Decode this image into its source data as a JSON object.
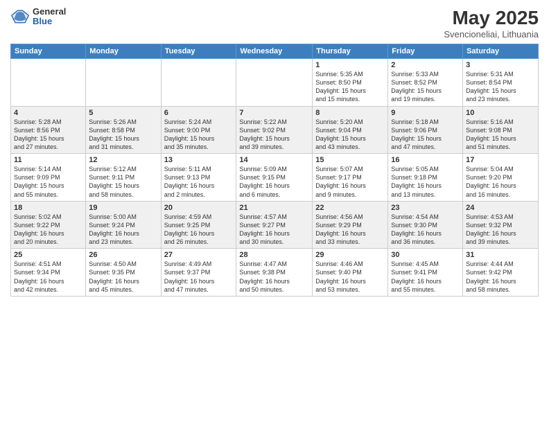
{
  "header": {
    "logo_general": "General",
    "logo_blue": "Blue",
    "title": "May 2025",
    "location": "Svencioneliai, Lithuania"
  },
  "days_of_week": [
    "Sunday",
    "Monday",
    "Tuesday",
    "Wednesday",
    "Thursday",
    "Friday",
    "Saturday"
  ],
  "weeks": [
    [
      {
        "day": "",
        "info": ""
      },
      {
        "day": "",
        "info": ""
      },
      {
        "day": "",
        "info": ""
      },
      {
        "day": "",
        "info": ""
      },
      {
        "day": "1",
        "info": "Sunrise: 5:35 AM\nSunset: 8:50 PM\nDaylight: 15 hours\nand 15 minutes."
      },
      {
        "day": "2",
        "info": "Sunrise: 5:33 AM\nSunset: 8:52 PM\nDaylight: 15 hours\nand 19 minutes."
      },
      {
        "day": "3",
        "info": "Sunrise: 5:31 AM\nSunset: 8:54 PM\nDaylight: 15 hours\nand 23 minutes."
      }
    ],
    [
      {
        "day": "4",
        "info": "Sunrise: 5:28 AM\nSunset: 8:56 PM\nDaylight: 15 hours\nand 27 minutes."
      },
      {
        "day": "5",
        "info": "Sunrise: 5:26 AM\nSunset: 8:58 PM\nDaylight: 15 hours\nand 31 minutes."
      },
      {
        "day": "6",
        "info": "Sunrise: 5:24 AM\nSunset: 9:00 PM\nDaylight: 15 hours\nand 35 minutes."
      },
      {
        "day": "7",
        "info": "Sunrise: 5:22 AM\nSunset: 9:02 PM\nDaylight: 15 hours\nand 39 minutes."
      },
      {
        "day": "8",
        "info": "Sunrise: 5:20 AM\nSunset: 9:04 PM\nDaylight: 15 hours\nand 43 minutes."
      },
      {
        "day": "9",
        "info": "Sunrise: 5:18 AM\nSunset: 9:06 PM\nDaylight: 15 hours\nand 47 minutes."
      },
      {
        "day": "10",
        "info": "Sunrise: 5:16 AM\nSunset: 9:08 PM\nDaylight: 15 hours\nand 51 minutes."
      }
    ],
    [
      {
        "day": "11",
        "info": "Sunrise: 5:14 AM\nSunset: 9:09 PM\nDaylight: 15 hours\nand 55 minutes."
      },
      {
        "day": "12",
        "info": "Sunrise: 5:12 AM\nSunset: 9:11 PM\nDaylight: 15 hours\nand 58 minutes."
      },
      {
        "day": "13",
        "info": "Sunrise: 5:11 AM\nSunset: 9:13 PM\nDaylight: 16 hours\nand 2 minutes."
      },
      {
        "day": "14",
        "info": "Sunrise: 5:09 AM\nSunset: 9:15 PM\nDaylight: 16 hours\nand 6 minutes."
      },
      {
        "day": "15",
        "info": "Sunrise: 5:07 AM\nSunset: 9:17 PM\nDaylight: 16 hours\nand 9 minutes."
      },
      {
        "day": "16",
        "info": "Sunrise: 5:05 AM\nSunset: 9:18 PM\nDaylight: 16 hours\nand 13 minutes."
      },
      {
        "day": "17",
        "info": "Sunrise: 5:04 AM\nSunset: 9:20 PM\nDaylight: 16 hours\nand 16 minutes."
      }
    ],
    [
      {
        "day": "18",
        "info": "Sunrise: 5:02 AM\nSunset: 9:22 PM\nDaylight: 16 hours\nand 20 minutes."
      },
      {
        "day": "19",
        "info": "Sunrise: 5:00 AM\nSunset: 9:24 PM\nDaylight: 16 hours\nand 23 minutes."
      },
      {
        "day": "20",
        "info": "Sunrise: 4:59 AM\nSunset: 9:25 PM\nDaylight: 16 hours\nand 26 minutes."
      },
      {
        "day": "21",
        "info": "Sunrise: 4:57 AM\nSunset: 9:27 PM\nDaylight: 16 hours\nand 30 minutes."
      },
      {
        "day": "22",
        "info": "Sunrise: 4:56 AM\nSunset: 9:29 PM\nDaylight: 16 hours\nand 33 minutes."
      },
      {
        "day": "23",
        "info": "Sunrise: 4:54 AM\nSunset: 9:30 PM\nDaylight: 16 hours\nand 36 minutes."
      },
      {
        "day": "24",
        "info": "Sunrise: 4:53 AM\nSunset: 9:32 PM\nDaylight: 16 hours\nand 39 minutes."
      }
    ],
    [
      {
        "day": "25",
        "info": "Sunrise: 4:51 AM\nSunset: 9:34 PM\nDaylight: 16 hours\nand 42 minutes."
      },
      {
        "day": "26",
        "info": "Sunrise: 4:50 AM\nSunset: 9:35 PM\nDaylight: 16 hours\nand 45 minutes."
      },
      {
        "day": "27",
        "info": "Sunrise: 4:49 AM\nSunset: 9:37 PM\nDaylight: 16 hours\nand 47 minutes."
      },
      {
        "day": "28",
        "info": "Sunrise: 4:47 AM\nSunset: 9:38 PM\nDaylight: 16 hours\nand 50 minutes."
      },
      {
        "day": "29",
        "info": "Sunrise: 4:46 AM\nSunset: 9:40 PM\nDaylight: 16 hours\nand 53 minutes."
      },
      {
        "day": "30",
        "info": "Sunrise: 4:45 AM\nSunset: 9:41 PM\nDaylight: 16 hours\nand 55 minutes."
      },
      {
        "day": "31",
        "info": "Sunrise: 4:44 AM\nSunset: 9:42 PM\nDaylight: 16 hours\nand 58 minutes."
      }
    ]
  ]
}
